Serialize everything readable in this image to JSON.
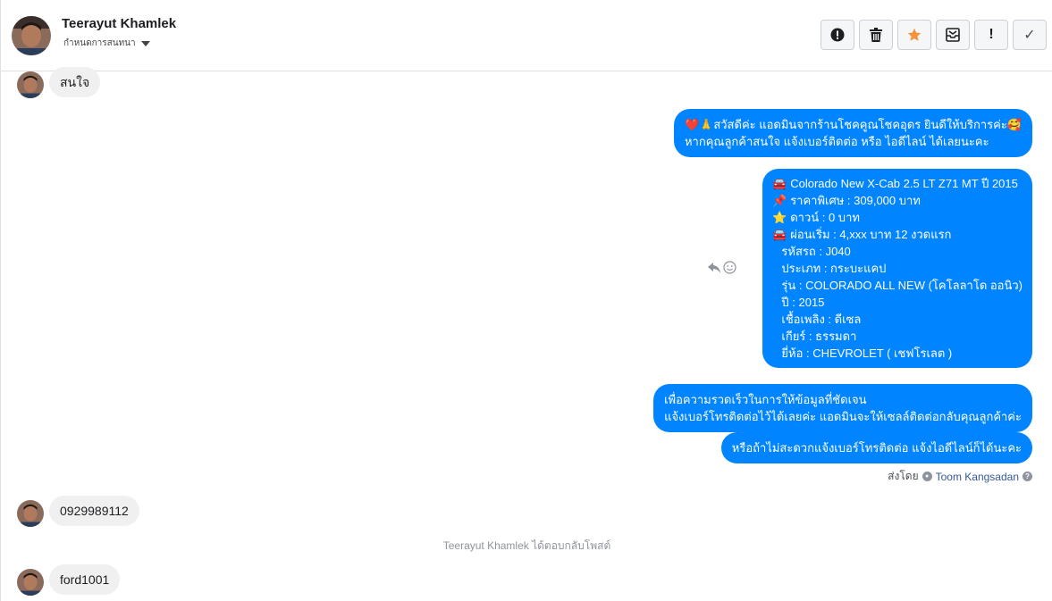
{
  "header": {
    "contact_name": "Teerayut Khamlek",
    "status_label": "กำหนดการสนทนา",
    "toolbar": [
      {
        "icon": "alert-circle-icon",
        "glyph": "!"
      },
      {
        "icon": "trash-icon",
        "glyph": ""
      },
      {
        "icon": "star-icon",
        "glyph": "★"
      },
      {
        "icon": "archive-icon",
        "glyph": ""
      },
      {
        "icon": "exclamation-icon",
        "glyph": "!"
      },
      {
        "icon": "check-icon",
        "glyph": "✓"
      }
    ]
  },
  "messages": {
    "m1": "สนใจ",
    "m2": [
      "❤️🙏สวัสดีค่ะ แอดมินจากร้านโชคคูณโชคอุดร ยินดีให้บริการค่ะ🥰",
      "หากคุณลูกค้าสนใจ แจ้งเบอร์ติดต่อ หรือ ไอดีไลน์ ได้เลยนะคะ"
    ],
    "m3": [
      "🚘 Colorado New X-Cab 2.5 LT Z71 MT ปี 2015",
      "📌 ราคาพิเศษ : 309,000 บาท",
      "⭐ ดาวน์ : 0 บาท",
      "🚘 ผ่อนเริ่ม : 4,xxx บาท 12 งวดแรก",
      "   รหัสรถ : J040",
      "   ประเภท : กระบะแคป",
      "   รุ่น : COLORADO ALL NEW (โคโลลาโด ออนิว)",
      "   ปี : 2015",
      "   เชื้อเพลิง : ดีเซล",
      "   เกียร์ : ธรรมดา",
      "   ยี่ห้อ : CHEVROLET ( เชฟโรเลต )"
    ],
    "m4": [
      "เพื่อความรวดเร็วในการให้ข้อมูลที่ชัดเจน",
      "แจ้งเบอร์โทรติดต่อไว้ได้เลยค่ะ แอดมินจะให้เซลล์ติดต่อกลับคุณลูกค้าค่ะ"
    ],
    "m5": "หรือถ้าไม่สะดวกแจ้งเบอร์โทรติดต่อ แจ้งไอดีไลน์ก็ได้นะคะ",
    "m6": "0929989112",
    "m7": "ford1001"
  },
  "sent_by": {
    "prefix": "ส่งโดย",
    "agent": "Toom Kangsadan"
  },
  "system_note": "Teerayut Khamlek ได้ตอบกลับโพสต์",
  "colors": {
    "outgoing_bubble": "#0084ff",
    "incoming_bubble": "#f1f0f0",
    "star": "#f7923a"
  }
}
